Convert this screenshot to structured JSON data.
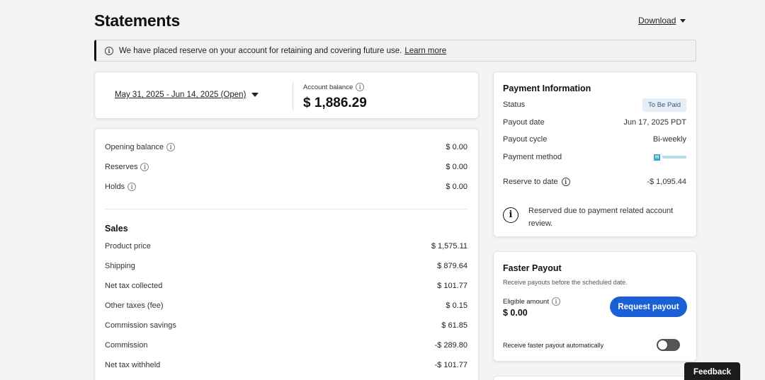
{
  "header": {
    "title": "Statements",
    "download_label": "Download"
  },
  "notice": {
    "text": "We have placed reserve on your account for retaining and covering future use.",
    "link": "Learn more"
  },
  "balance": {
    "date_range": "May 31, 2025 - Jun 14, 2025 (Open)",
    "account_balance_label": "Account balance",
    "account_balance_value": "$ 1,886.29"
  },
  "ledger": {
    "summary": [
      {
        "label": "Opening balance",
        "value": "$ 0.00"
      },
      {
        "label": "Reserves",
        "value": "$ 0.00"
      },
      {
        "label": "Holds",
        "value": "$ 0.00"
      }
    ],
    "sales_title": "Sales",
    "sales": [
      {
        "label": "Product price",
        "value": "$ 1,575.11"
      },
      {
        "label": "Shipping",
        "value": "$ 879.64"
      },
      {
        "label": "Net tax collected",
        "value": "$ 101.77"
      },
      {
        "label": "Other taxes (fee)",
        "value": "$ 0.15"
      },
      {
        "label": "Commission savings",
        "value": "$ 61.85"
      },
      {
        "label": "Commission",
        "value": "-$ 289.80"
      },
      {
        "label": "Net tax withheld",
        "value": "-$ 101.77"
      }
    ]
  },
  "payment": {
    "title": "Payment Information",
    "status_label": "Status",
    "status_value": "To Be Paid",
    "payout_date_label": "Payout date",
    "payout_date_value": "Jun 17, 2025 PDT",
    "payout_cycle_label": "Payout cycle",
    "payout_cycle_value": "Bi-weekly",
    "method_label": "Payment method",
    "method_icon": "payment-provider-logo",
    "reserve_label": "Reserve to date",
    "reserve_value": "-$ 1,095.44",
    "reserve_note": "Reserved due to payment related account review."
  },
  "faster_payout": {
    "title": "Faster Payout",
    "subtitle": "Receive payouts before the scheduled date.",
    "eligible_label": "Eligible amount",
    "eligible_value": "$ 0.00",
    "request_button": "Request payout",
    "auto_label": "Receive faster payout automatically",
    "auto_enabled": false
  },
  "feedback_label": "Feedback",
  "colors": {
    "accent": "#1a5fd6",
    "background": "#f5f3f6",
    "badge_bg": "#e5eef7"
  }
}
